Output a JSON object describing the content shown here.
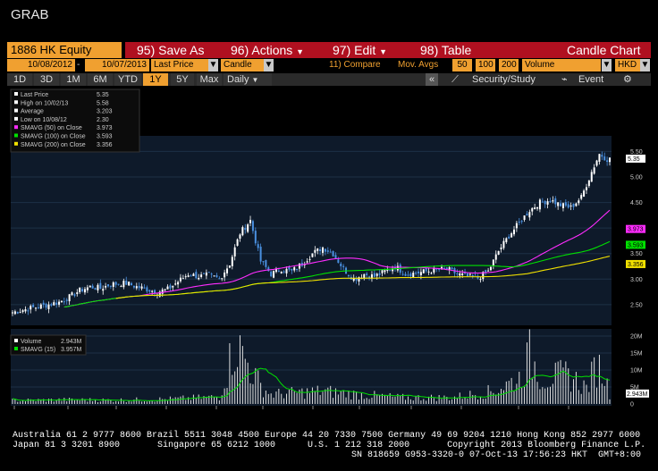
{
  "window_title": "GRAB",
  "toolbar": {
    "ticker": "1886 HK Equity",
    "save_num": "95)",
    "save_label": "Save As",
    "actions_num": "96)",
    "actions_label": "Actions",
    "edit_num": "97)",
    "edit_label": "Edit",
    "table_num": "98)",
    "table_label": "Table",
    "chart_type": "Candle Chart"
  },
  "settings": {
    "start_date": "10/08/2012",
    "end_date": "10/07/2013",
    "price_field": "Last Price",
    "style": "Candle",
    "compare": "11) Compare",
    "mov_avgs_label": "Mov. Avgs",
    "ma1": "50",
    "ma2": "100",
    "ma3": "200",
    "lower_field": "Volume",
    "currency": "HKD"
  },
  "periods": [
    "1D",
    "3D",
    "1M",
    "6M",
    "YTD",
    "1Y",
    "5Y",
    "Max"
  ],
  "active_period": "1Y",
  "frequency": "Daily",
  "security_study": "Security/Study",
  "event": "Event",
  "legend": [
    {
      "label": "Last Price",
      "value": "5.35"
    },
    {
      "label": "High on 10/02/13",
      "value": "5.58"
    },
    {
      "label": "Average",
      "value": "3.203"
    },
    {
      "label": "Low on 10/08/12",
      "value": "2.30"
    },
    {
      "label": "SMAVG (50) on Close",
      "value": "3.973"
    },
    {
      "label": "SMAVG (100) on Close",
      "value": "3.593"
    },
    {
      "label": "SMAVG (200) on Close",
      "value": "3.356"
    }
  ],
  "volume_legend": [
    {
      "label": "Volume",
      "value": "2.943M"
    },
    {
      "label": "SMAVG (15)",
      "value": "3.957M"
    }
  ],
  "price_tags": [
    "5.35",
    "3.973",
    "3.593",
    "3.356"
  ],
  "volume_tag": "2.943M",
  "colors": {
    "up": "#ffffff",
    "down": "#4a90e0",
    "sma50": "#ff2cff",
    "sma100": "#00e000",
    "sma200": "#f0e000",
    "accent": "#f0a030",
    "menubar": "#b01020"
  },
  "chart_data": {
    "type": "candlestick",
    "y_ticks": [
      "5.50",
      "5.00",
      "4.50",
      "4.00",
      "3.50",
      "3.00",
      "2.50"
    ],
    "ylim": [
      2.2,
      5.7
    ],
    "volume_ticks": [
      "20M",
      "15M",
      "10M",
      "5M",
      "0"
    ],
    "volume_ylim": [
      0,
      20
    ],
    "x_labels": [
      "Oct",
      "Nov",
      "Dec",
      "Jan",
      "Feb",
      "Mar",
      "Apr",
      "May",
      "Jun",
      "Jul",
      "Aug",
      "Sep"
    ],
    "year_labels": [
      "2012",
      "2013"
    ],
    "price_anchors": [
      [
        0,
        2.35
      ],
      [
        6,
        2.42
      ],
      [
        12,
        2.48
      ],
      [
        18,
        2.55
      ],
      [
        22,
        2.65
      ],
      [
        26,
        2.78
      ],
      [
        30,
        2.85
      ],
      [
        34,
        2.82
      ],
      [
        38,
        2.9
      ],
      [
        44,
        2.92
      ],
      [
        48,
        2.85
      ],
      [
        52,
        2.8
      ],
      [
        56,
        2.75
      ],
      [
        60,
        2.8
      ],
      [
        64,
        2.95
      ],
      [
        68,
        3.1
      ],
      [
        72,
        3.05
      ],
      [
        76,
        3.08
      ],
      [
        80,
        3.0
      ],
      [
        84,
        3.3
      ],
      [
        88,
        3.9
      ],
      [
        92,
        4.15
      ],
      [
        96,
        3.35
      ],
      [
        100,
        3.1
      ],
      [
        104,
        3.2
      ],
      [
        108,
        3.15
      ],
      [
        112,
        3.3
      ],
      [
        116,
        3.5
      ],
      [
        120,
        3.62
      ],
      [
        124,
        3.5
      ],
      [
        128,
        3.2
      ],
      [
        132,
        3.0
      ],
      [
        136,
        3.1
      ],
      [
        140,
        3.05
      ],
      [
        144,
        3.15
      ],
      [
        148,
        3.25
      ],
      [
        152,
        3.1
      ],
      [
        156,
        3.12
      ],
      [
        160,
        3.15
      ],
      [
        164,
        3.18
      ],
      [
        168,
        3.2
      ],
      [
        172,
        3.1
      ],
      [
        176,
        3.05
      ],
      [
        180,
        3.02
      ],
      [
        184,
        3.15
      ],
      [
        188,
        3.55
      ],
      [
        192,
        3.85
      ],
      [
        196,
        4.1
      ],
      [
        200,
        4.35
      ],
      [
        204,
        4.5
      ],
      [
        208,
        4.55
      ],
      [
        212,
        4.45
      ],
      [
        216,
        4.4
      ],
      [
        220,
        4.6
      ],
      [
        224,
        5.1
      ],
      [
        227,
        5.45
      ],
      [
        230,
        5.35
      ]
    ],
    "volume_anchors": [
      [
        0,
        1.1
      ],
      [
        20,
        1.3
      ],
      [
        40,
        1.2
      ],
      [
        60,
        1.5
      ],
      [
        80,
        2.2
      ],
      [
        86,
        18.5
      ],
      [
        90,
        14.0
      ],
      [
        96,
        5.5
      ],
      [
        100,
        3.0
      ],
      [
        120,
        4.0
      ],
      [
        130,
        3.2
      ],
      [
        150,
        2.0
      ],
      [
        170,
        2.0
      ],
      [
        186,
        4.0
      ],
      [
        196,
        8.0
      ],
      [
        200,
        15.0
      ],
      [
        205,
        8.0
      ],
      [
        215,
        9.0
      ],
      [
        222,
        5.0
      ],
      [
        226,
        12.0
      ],
      [
        229,
        9.0
      ],
      [
        231,
        2.9
      ]
    ],
    "candle_count": 232
  }
}
